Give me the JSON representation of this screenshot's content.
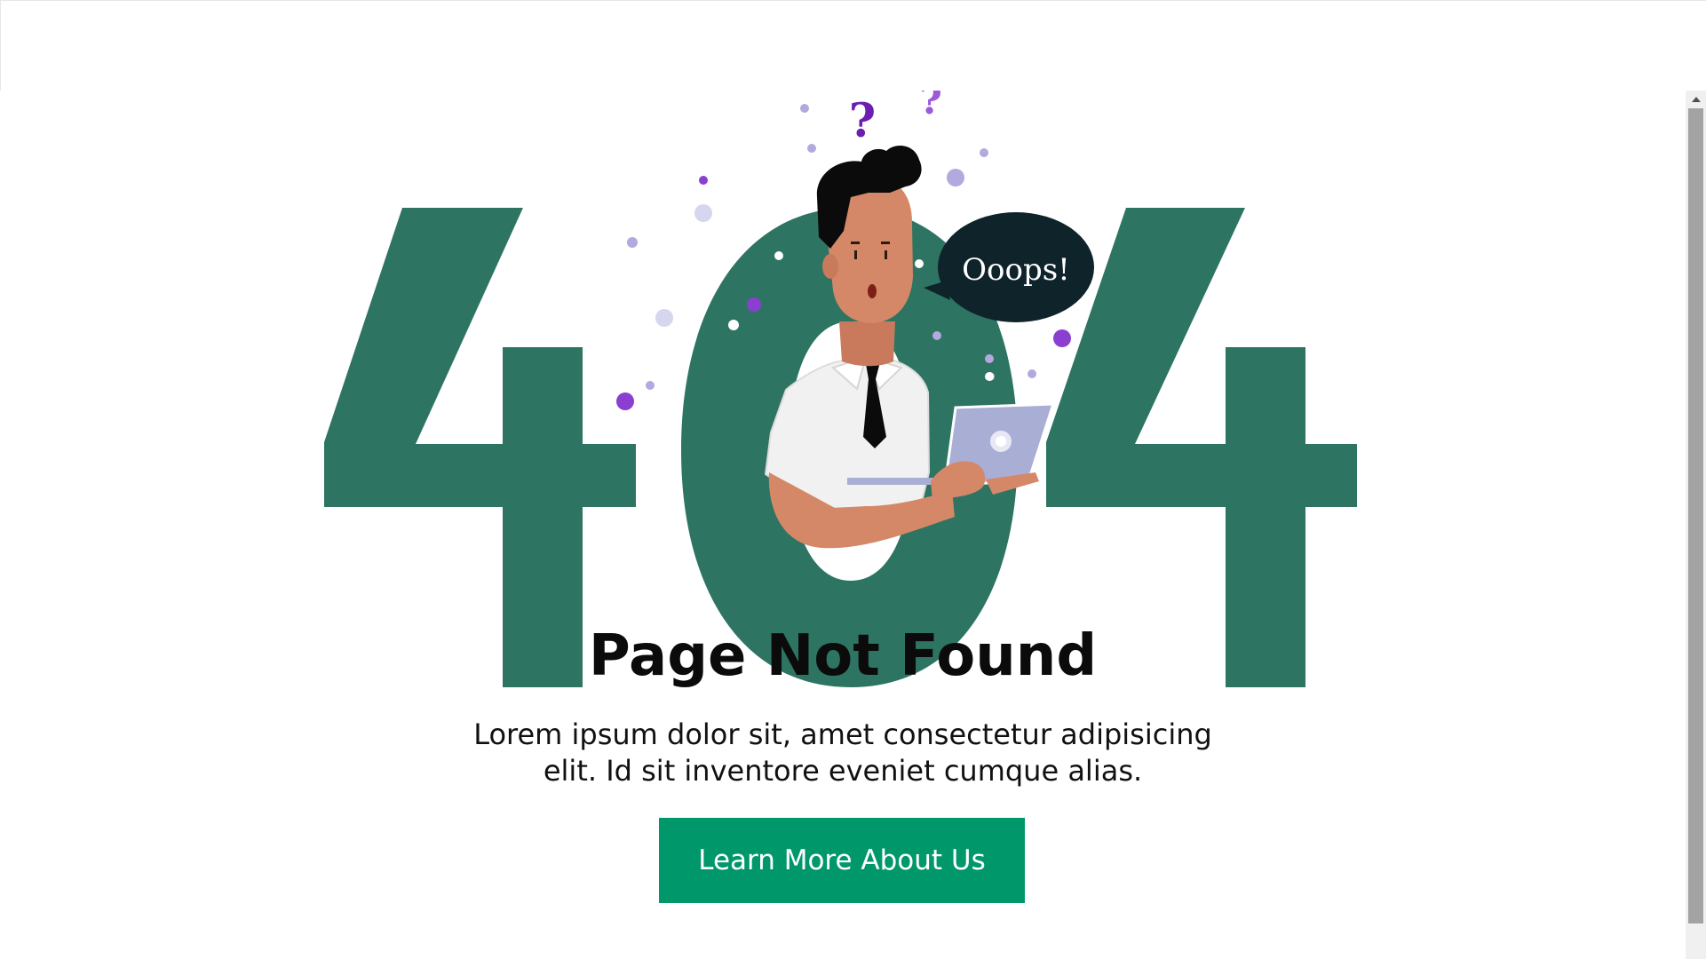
{
  "error_code": "404",
  "speech_bubble": "Ooops!",
  "illustration": {
    "question_mark": "?",
    "icons": [
      "person-with-tablet-icon",
      "speech-bubble-icon",
      "question-mark-icon"
    ]
  },
  "heading": "Page Not Found",
  "description": "Lorem ipsum dolor sit, amet consectetur adipisicing elit. Id sit inventore eveniet cumque alias.",
  "button_label": "Learn More About Us",
  "colors": {
    "digits": "#2e7462",
    "button": "#00986a",
    "bubble": "#0e232a",
    "accent_purple": "#8b3fd1",
    "accent_lavender": "#b3a9de",
    "skin": "#d48868",
    "tablet": "#a9aed4"
  },
  "scrollbar": {
    "icons": [
      "scroll-up-arrow-icon"
    ]
  }
}
